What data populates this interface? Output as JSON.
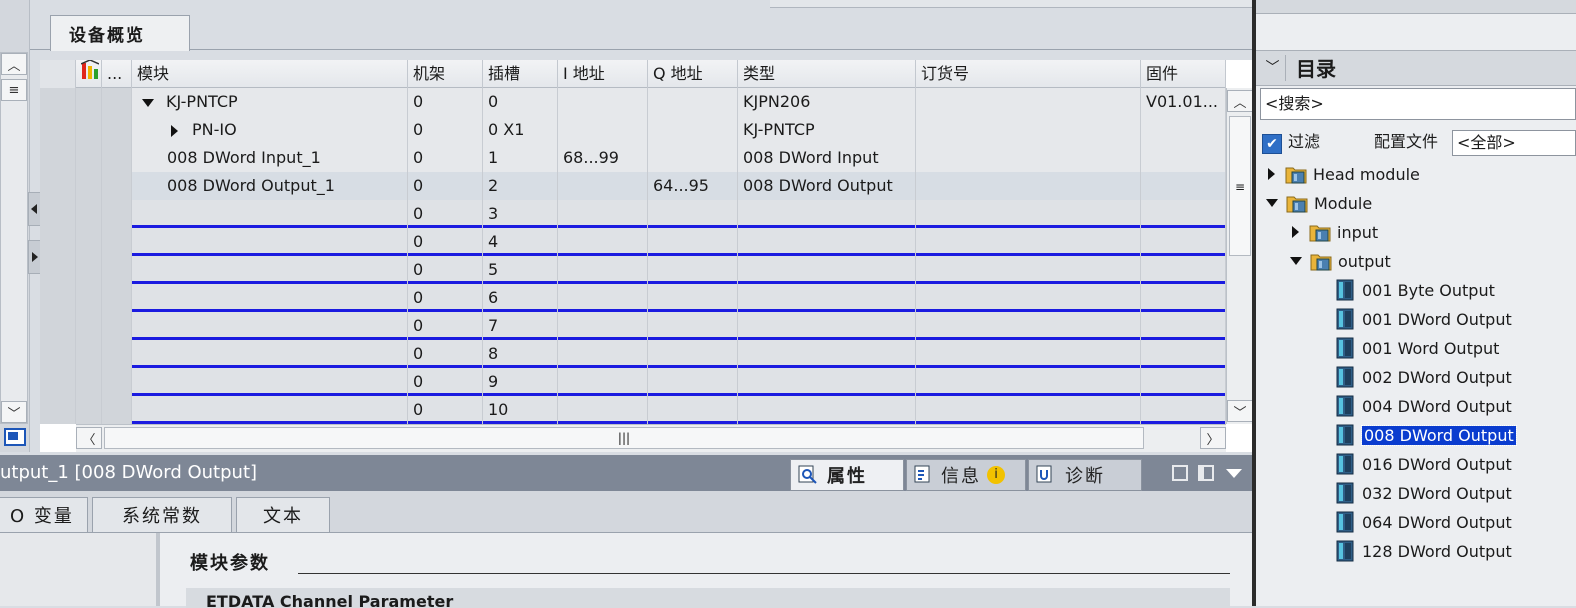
{
  "editor": {
    "tab_label": "设备概览"
  },
  "table": {
    "headers": [
      "",
      "...",
      "模块",
      "机架",
      "插槽",
      "I 地址",
      "Q 地址",
      "类型",
      "订货号",
      "固件"
    ],
    "rows": [
      {
        "module": "KJ-PNTCP",
        "rack": "0",
        "slot": "0",
        "i_addr": "",
        "q_addr": "",
        "type": "KJPN206",
        "order": "",
        "fw": "V01.01..."
      },
      {
        "module": "PN-IO",
        "rack": "0",
        "slot": "0 X1",
        "i_addr": "",
        "q_addr": "",
        "type": "KJ-PNTCP",
        "order": "",
        "fw": ""
      },
      {
        "module": "008 DWord Input_1",
        "rack": "0",
        "slot": "1",
        "i_addr": "68...99",
        "q_addr": "",
        "type": "008 DWord Input",
        "order": "",
        "fw": ""
      },
      {
        "module": "008 DWord Output_1",
        "rack": "0",
        "slot": "2",
        "i_addr": "",
        "q_addr": "64...95",
        "type": "008 DWord Output",
        "order": "",
        "fw": ""
      },
      {
        "module": "",
        "rack": "0",
        "slot": "3",
        "i_addr": "",
        "q_addr": "",
        "type": "",
        "order": "",
        "fw": ""
      },
      {
        "module": "",
        "rack": "0",
        "slot": "4",
        "i_addr": "",
        "q_addr": "",
        "type": "",
        "order": "",
        "fw": ""
      },
      {
        "module": "",
        "rack": "0",
        "slot": "5",
        "i_addr": "",
        "q_addr": "",
        "type": "",
        "order": "",
        "fw": ""
      },
      {
        "module": "",
        "rack": "0",
        "slot": "6",
        "i_addr": "",
        "q_addr": "",
        "type": "",
        "order": "",
        "fw": ""
      },
      {
        "module": "",
        "rack": "0",
        "slot": "7",
        "i_addr": "",
        "q_addr": "",
        "type": "",
        "order": "",
        "fw": ""
      },
      {
        "module": "",
        "rack": "0",
        "slot": "8",
        "i_addr": "",
        "q_addr": "",
        "type": "",
        "order": "",
        "fw": ""
      },
      {
        "module": "",
        "rack": "0",
        "slot": "9",
        "i_addr": "",
        "q_addr": "",
        "type": "",
        "order": "",
        "fw": ""
      },
      {
        "module": "",
        "rack": "0",
        "slot": "10",
        "i_addr": "",
        "q_addr": "",
        "type": "",
        "order": "",
        "fw": ""
      }
    ]
  },
  "inspector": {
    "title": "utput_1 [008 DWord Output]",
    "tabs": [
      "属性",
      "信息",
      "诊断"
    ],
    "subtabs": [
      "O 变量",
      "系统常数",
      "文本"
    ],
    "section_title": "模块参数",
    "subsection_title": "ETDATA Channel Parameter"
  },
  "catalog": {
    "title": "目录",
    "search_placeholder": "<搜索>",
    "filter_label": "过滤",
    "profile_label": "配置文件",
    "profile_value": "<全部>",
    "tree": {
      "head_module": "Head module",
      "module": "Module",
      "input": "input",
      "output": "output",
      "items": [
        "001 Byte Output",
        "001 DWord Output",
        "001 Word Output",
        "002 DWord Output",
        "004 DWord Output",
        "008 DWord Output",
        "016 DWord Output",
        "032 DWord Output",
        "064 DWord Output",
        "128 DWord Output"
      ],
      "selected_index": 5
    }
  },
  "colors": {
    "selection": "#0a3ccf",
    "empty_row_border": "#1b1be0",
    "inspector_title_bar": "#7e8796",
    "info_icon": "#f2c200"
  }
}
